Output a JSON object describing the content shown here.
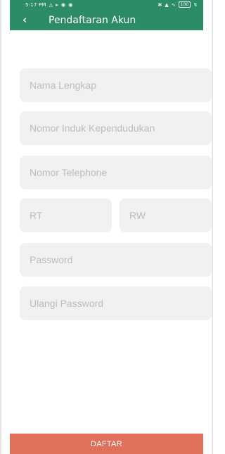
{
  "status_bar": {
    "time": "5:17 PM",
    "icons_left": [
      "signal-bars-icon",
      "play-icon",
      "circle-icon",
      "circle-icon"
    ],
    "icons_right": [
      "bluetooth-icon",
      "signal-icon",
      "wifi-icon",
      "battery-icon",
      "charging-icon"
    ],
    "battery": "100",
    "background_color": "#2d8c68"
  },
  "app_bar": {
    "title": "Pendaftaran Akun",
    "back_icon": "chevron-left-icon",
    "background_color": "#2d8c68"
  },
  "form": {
    "full_name": {
      "value": "",
      "placeholder": "Nama Lengkap"
    },
    "nik": {
      "value": "",
      "placeholder": "Nomor Induk Kependudukan"
    },
    "phone": {
      "value": "",
      "placeholder": "Nomor Telephone"
    },
    "rt": {
      "value": "",
      "placeholder": "RT"
    },
    "rw": {
      "value": "",
      "placeholder": "RW"
    },
    "password": {
      "value": "",
      "placeholder": "Password"
    },
    "confirm_password": {
      "value": "",
      "placeholder": "Ulangi Password"
    }
  },
  "footer": {
    "daftar_label": "DAFTAR",
    "background_color": "#e0705c"
  }
}
